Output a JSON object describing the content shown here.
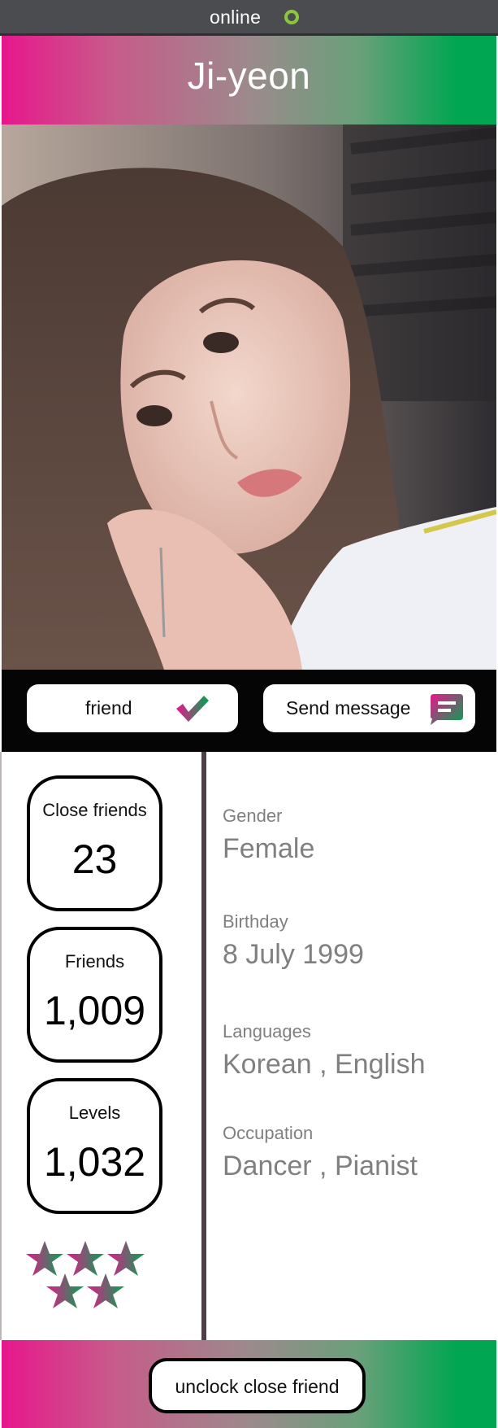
{
  "status": {
    "text": "online",
    "indicator_color": "#8cc63f"
  },
  "header": {
    "name": "Ji-yeon",
    "gradient": [
      "#e8168c",
      "#00a651"
    ]
  },
  "profile_photo": {
    "icon": "profile-photo"
  },
  "actions": {
    "friend_label": "friend",
    "friend_icon": "checkmark-icon",
    "message_label": "Send message",
    "message_icon": "chat-bubble-icon"
  },
  "stats": [
    {
      "label": "Close friends",
      "value": "23"
    },
    {
      "label": "Friends",
      "value": "1,009"
    },
    {
      "label": "Levels",
      "value": "1,032"
    }
  ],
  "rating": {
    "stars": 5,
    "icon": "star-icon"
  },
  "info": [
    {
      "label": "Gender",
      "value": "Female"
    },
    {
      "label": "Birthday",
      "value": "8 July 1999"
    },
    {
      "label": "Languages",
      "value": "Korean , English"
    },
    {
      "label": "Occupation",
      "value": "Dancer ,  Pianist"
    }
  ],
  "footer": {
    "button_label": "unclock close friend"
  }
}
